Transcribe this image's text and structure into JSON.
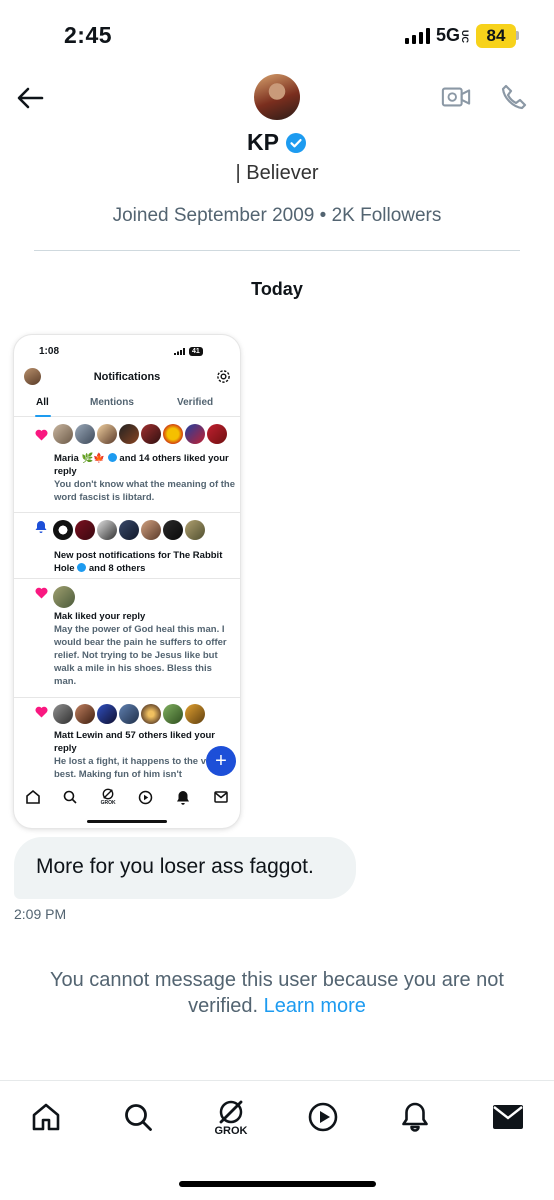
{
  "status_bar": {
    "time": "2:45",
    "network": "5G",
    "network_sub": "UC",
    "battery": "84"
  },
  "header": {
    "name": "KP",
    "bio_fragment": "| Believer",
    "joined": "Joined September 2009 • 2K Followers"
  },
  "conversation": {
    "day_label": "Today",
    "screenshot": {
      "time": "1:08",
      "battery": "41",
      "title": "Notifications",
      "tabs": [
        "All",
        "Mentions",
        "Verified"
      ],
      "notifications": [
        {
          "headline_a": "Maria",
          "headline_b": "and 14 others liked your reply",
          "body": "You don't know what the meaning of the word fascist is libtard."
        },
        {
          "headline_a": "New post notifications for The Rabbit Hole",
          "headline_b": "and 8 others",
          "body": ""
        },
        {
          "headline_a": "Mak liked your reply",
          "headline_b": "",
          "body": "May the power of God heal this man. I would bear the pain he suffers to offer relief. Not trying to be Jesus like but walk a mile in his shoes. Bless this man."
        },
        {
          "headline_a": "Matt Lewin and 57 others liked your reply",
          "headline_b": "",
          "body": "He lost a fight, it happens to the very best. Making fun of him isn't"
        }
      ],
      "nav_grok_label": "GROK"
    },
    "message": {
      "text": "More for you loser ass faggot.",
      "time": "2:09 PM"
    },
    "notice": {
      "text": "You cannot message this user because you are not verified.",
      "link": "Learn more"
    }
  },
  "bottom_nav": {
    "grok_label": "GROK"
  },
  "colors": {
    "accent": "#1d9bf0",
    "like": "#f91880",
    "secondary_text": "#536471"
  },
  "icons": [
    "back-arrow-icon",
    "video-call-icon",
    "phone-icon",
    "verified-badge-icon",
    "home-icon",
    "search-icon",
    "grok-icon",
    "play-icon",
    "bell-icon",
    "mail-icon"
  ]
}
